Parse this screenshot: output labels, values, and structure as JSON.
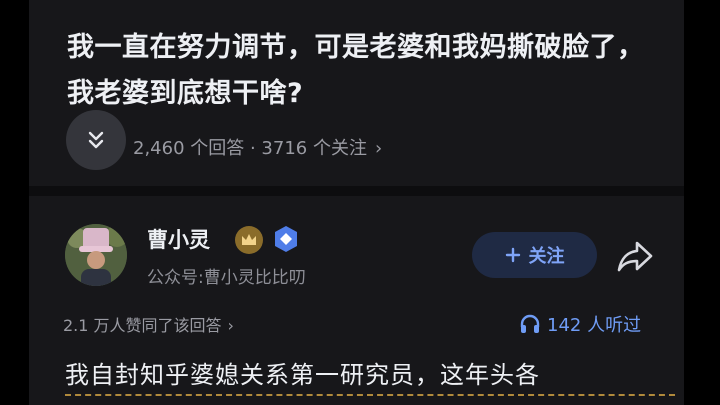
{
  "question": {
    "title": "我一直在努力调节，可是老婆和我妈撕破脸了，我老婆到底想干啥?",
    "stats": "2,460 个回答 · 3716 个关注",
    "stats_chevron": "›"
  },
  "author": {
    "name": "曹小灵",
    "description": "公众号:曹小灵比比叨",
    "follow_label": "关注",
    "follow_icon": "plus-icon",
    "share_icon": "share-icon"
  },
  "answer": {
    "upvotes": "2.1 万人赞同了该回答",
    "upvotes_chevron": "›",
    "listeners": "142 人听过",
    "body_first_line": "我自封知乎婆媳关系第一研究员，这年头各"
  },
  "colors": {
    "background": "#17171a",
    "accent": "#7fa4f7",
    "listen": "#6f9cf5",
    "text": "#eef0f4",
    "muted": "#9a9ba3"
  }
}
